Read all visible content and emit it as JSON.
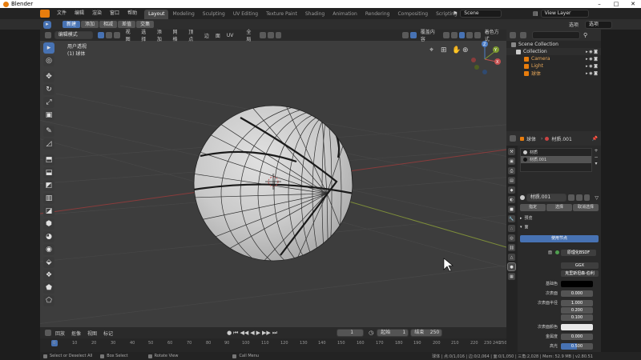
{
  "window": {
    "title": "Blender",
    "minimize": "–",
    "maximize": "□",
    "close": "✕"
  },
  "menubar": {
    "items": [
      "文件",
      "编辑",
      "渲染",
      "窗口",
      "帮助"
    ]
  },
  "workspaces": {
    "tabs": [
      "Layout",
      "Modeling",
      "Sculpting",
      "UV Editing",
      "Texture Paint",
      "Shading",
      "Animation",
      "Rendering",
      "Compositing",
      "Scripting"
    ],
    "add": "+"
  },
  "scene": {
    "name": "Scene",
    "view_layer": "View Layer"
  },
  "tool_header": {
    "new": "新建",
    "add": "添加",
    "subtract": "相减",
    "difference": "差值",
    "intersect": "交集",
    "options": "选项",
    "dropdown": "选项"
  },
  "viewport_header": {
    "mode": "编辑模式",
    "menus": [
      "视图",
      "选择",
      "添加",
      "网格",
      "顶点",
      "边",
      "面",
      "UV"
    ],
    "orientation": "全局",
    "overlay": "覆盖内容",
    "shading_label": "着色方式"
  },
  "viewport": {
    "view_name": "用户透视",
    "object_label": "(1) 球体",
    "axes": {
      "x": "X",
      "y": "Y",
      "z": "Z"
    }
  },
  "outliner": {
    "root": "Scene Collection",
    "collection": "Collection",
    "items": [
      "Camera",
      "Light",
      "球体"
    ]
  },
  "properties": {
    "object_name": "球体",
    "material_name": "材质.001",
    "slots": [
      "材质",
      "材质.001"
    ],
    "material_field": "材质.001",
    "btn_assign": "指定",
    "btn_select": "选择",
    "btn_deselect": "取消选择",
    "preview_label": "预览",
    "surface_label": "面",
    "use_nodes": "使用节点",
    "surface_prop": "面",
    "surface_val": "原理化BSDF",
    "distribution": "GGX",
    "subsurface_method": "克里斯坦森-伯利",
    "rows": [
      {
        "label": "基础色",
        "val": ""
      },
      {
        "label": "次表面",
        "val": "0.000"
      },
      {
        "label": "次表面半径",
        "val": "1.000"
      },
      {
        "label": "",
        "val": "0.200"
      },
      {
        "label": "",
        "val": "0.100"
      },
      {
        "label": "次表面颜色",
        "val": ""
      },
      {
        "label": "金属度",
        "val": "0.000"
      },
      {
        "label": "高光",
        "val": "0.500"
      }
    ]
  },
  "timeline": {
    "menus": [
      "回放",
      "抠像",
      "视图",
      "标记"
    ],
    "current": "1",
    "start_label": "起始",
    "start": "1",
    "end_label": "结束",
    "end": "250",
    "ticks": [
      "0",
      "10",
      "20",
      "30",
      "40",
      "50",
      "60",
      "70",
      "80",
      "90",
      "100",
      "110",
      "120",
      "130",
      "140",
      "150",
      "160",
      "170",
      "180",
      "190",
      "200",
      "210",
      "220",
      "230",
      "240",
      "250"
    ]
  },
  "statusbar": {
    "left1": "Select or Deselect All",
    "left2": "Box Select",
    "left3": "Rotate View",
    "left4": "Call Menu",
    "right": "球体 | 点:0/1,016 | 边:0/2,064 | 面:0/1,050 | 三角:2,028 | Mem: 52.9 MB | v2.80.51"
  }
}
